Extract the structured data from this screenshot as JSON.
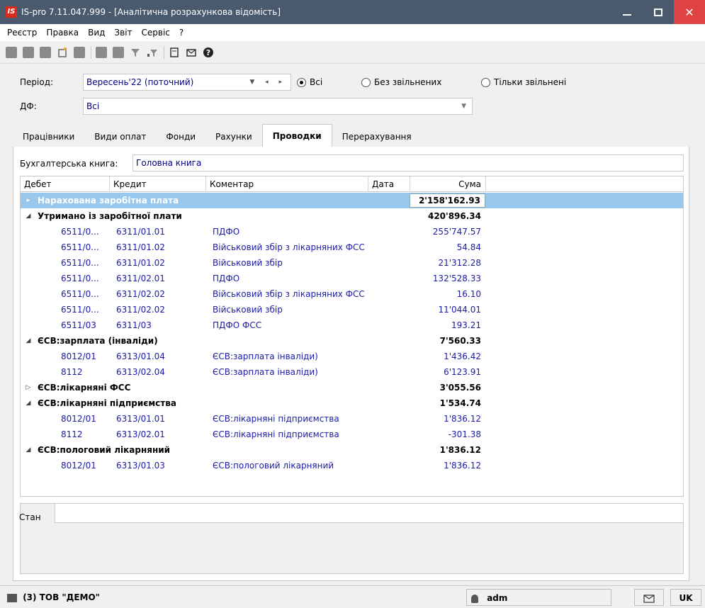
{
  "window": {
    "logo": "IS",
    "title": "IS-pro 7.11.047.999 - [Аналітична розрахункова відомість]"
  },
  "menu": [
    "Реєстр",
    "Правка",
    "Вид",
    "Звіт",
    "Сервіс",
    "?"
  ],
  "filters": {
    "period_label": "Період:",
    "period_value": "Вересень'22 (поточний)",
    "df_label": "ДФ:",
    "df_value": "Всі",
    "radios": [
      {
        "label": "Всі",
        "checked": true
      },
      {
        "label": "Без звільнених",
        "checked": false
      },
      {
        "label": "Тільки звільнені",
        "checked": false
      }
    ]
  },
  "tabs": [
    "Працівники",
    "Види оплат",
    "Фонди",
    "Рахунки",
    "Проводки",
    "Перерахування"
  ],
  "active_tab": 4,
  "book": {
    "label": "Бухгалтерська книга:",
    "value": "Головна книга"
  },
  "grid": {
    "columns": [
      "Дебет",
      "Кредит",
      "Коментар",
      "Дата",
      "Сума"
    ],
    "rows": [
      {
        "type": "group",
        "toggle": "▸",
        "title": "Нарахована заробітна плата",
        "sum": "2'158'162.93",
        "selected": true
      },
      {
        "type": "group",
        "toggle": "◢",
        "title": "Утримано із заробітної плати",
        "sum": "420'896.34"
      },
      {
        "type": "detail",
        "debit": "6511/0...",
        "credit": "6311/01.01",
        "comment": "ПДФО",
        "sum": "255'747.57"
      },
      {
        "type": "detail",
        "debit": "6511/0...",
        "credit": "6311/01.02",
        "comment": "Військовий збір з лікарняних ФСС",
        "sum": "54.84"
      },
      {
        "type": "detail",
        "debit": "6511/0...",
        "credit": "6311/01.02",
        "comment": "Військовий збір",
        "sum": "21'312.28"
      },
      {
        "type": "detail",
        "debit": "6511/0...",
        "credit": "6311/02.01",
        "comment": "ПДФО",
        "sum": "132'528.33"
      },
      {
        "type": "detail",
        "debit": "6511/0...",
        "credit": "6311/02.02",
        "comment": "Військовий збір з лікарняних ФСС",
        "sum": "16.10"
      },
      {
        "type": "detail",
        "debit": "6511/0...",
        "credit": "6311/02.02",
        "comment": "Військовий збір",
        "sum": "11'044.01"
      },
      {
        "type": "detail",
        "debit": "6511/03",
        "credit": "6311/03",
        "comment": "ПДФО ФСС",
        "sum": "193.21"
      },
      {
        "type": "group",
        "toggle": "◢",
        "title": "ЄСВ:зарплата  (інваліди)",
        "sum": "7'560.33"
      },
      {
        "type": "detail",
        "debit": "8012/01",
        "credit": "6313/01.04",
        "comment": "ЄСВ:зарплата інваліди)",
        "sum": "1'436.42"
      },
      {
        "type": "detail",
        "debit": "8112",
        "credit": "6313/02.04",
        "comment": "ЄСВ:зарплата інваліди)",
        "sum": "6'123.91"
      },
      {
        "type": "group",
        "toggle": "▷",
        "title": "ЄСВ:лікарняні ФСС",
        "sum": "3'055.56"
      },
      {
        "type": "group",
        "toggle": "◢",
        "title": "ЄСВ:лікарняні підприємства",
        "sum": "1'534.74"
      },
      {
        "type": "detail",
        "debit": "8012/01",
        "credit": "6313/01.01",
        "comment": "ЄСВ:лікарняні підприємства",
        "sum": "1'836.12"
      },
      {
        "type": "detail",
        "debit": "8112",
        "credit": "6313/02.01",
        "comment": "ЄСВ:лікарняні підприємства",
        "sum": "-301.38"
      },
      {
        "type": "group",
        "toggle": "◢",
        "title": "ЄСВ:пологовий лікарняний",
        "sum": "1'836.12"
      },
      {
        "type": "detail",
        "debit": "8012/01",
        "credit": "6313/01.03",
        "comment": "ЄСВ:пологовий лікарняний",
        "sum": "1'836.12"
      }
    ]
  },
  "state": {
    "label": "Стан",
    "value": ""
  },
  "statusbar": {
    "company": "(3) ТОВ \"ДЕМО\"",
    "user": "adm",
    "lang": "UK"
  },
  "colors": {
    "titlebar": "#4a5a6e",
    "selected_row": "#98c8ee",
    "link_text": "#1a1aa8"
  }
}
